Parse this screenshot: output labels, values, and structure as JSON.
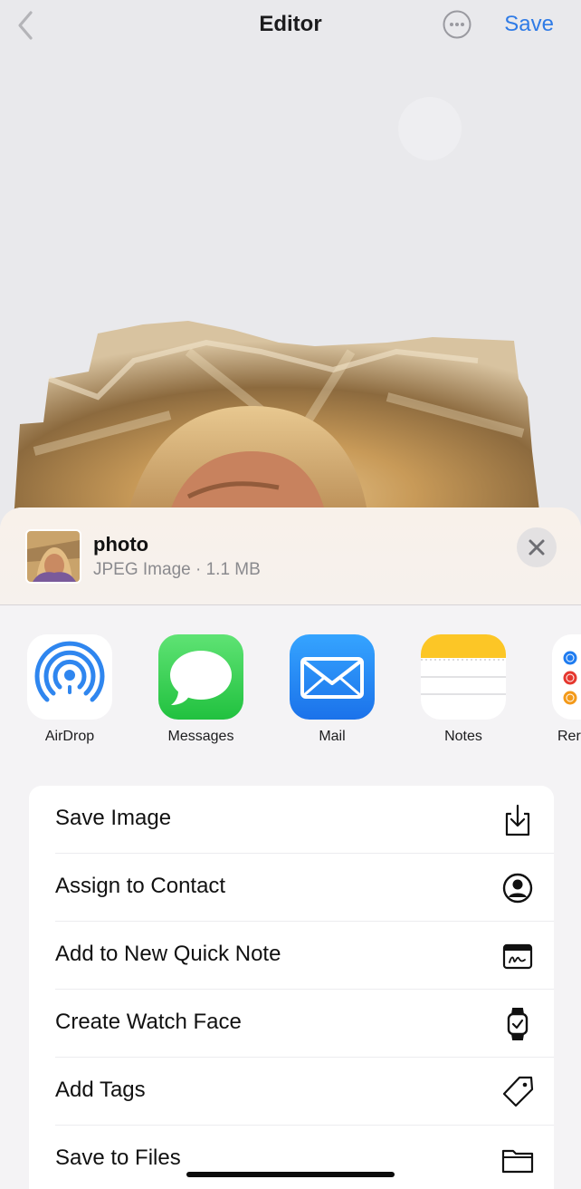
{
  "nav": {
    "title": "Editor",
    "save_label": "Save",
    "back_icon": "chevron-left-icon",
    "more_icon": "ellipsis-circle-icon",
    "accent_color": "#2f7be6"
  },
  "sheet": {
    "file_name": "photo",
    "file_meta": "JPEG Image · 1.1 MB",
    "close_icon": "close-icon"
  },
  "apps": [
    {
      "label": "AirDrop",
      "icon": "airdrop-icon"
    },
    {
      "label": "Messages",
      "icon": "messages-icon"
    },
    {
      "label": "Mail",
      "icon": "mail-icon"
    },
    {
      "label": "Notes",
      "icon": "notes-icon"
    },
    {
      "label": "Rer",
      "icon": "reminders-icon"
    }
  ],
  "actions": [
    {
      "label": "Save Image",
      "icon": "save-image-icon"
    },
    {
      "label": "Assign to Contact",
      "icon": "contact-icon"
    },
    {
      "label": "Add to New Quick Note",
      "icon": "quick-note-icon"
    },
    {
      "label": "Create Watch Face",
      "icon": "watch-icon"
    },
    {
      "label": "Add Tags",
      "icon": "tag-icon"
    },
    {
      "label": "Save to Files",
      "icon": "folder-icon"
    }
  ]
}
